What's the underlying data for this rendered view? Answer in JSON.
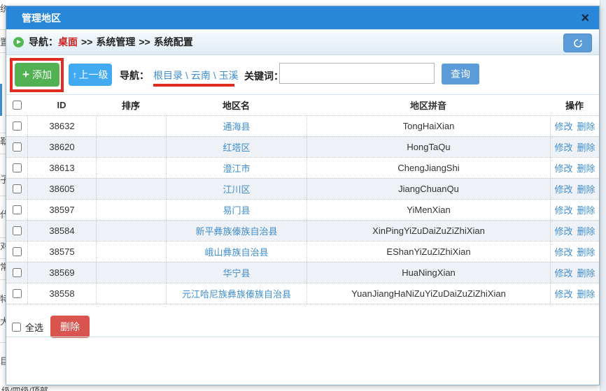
{
  "modal": {
    "title": "管理地区",
    "breadcrumb": {
      "label": "导航：",
      "desktop": "桌面",
      "separator": ">>",
      "item1": "系统管理",
      "item2": "系统配置"
    },
    "toolbar": {
      "add_label": "添加",
      "up_label": "上一级",
      "path_label": "导航：",
      "path_items": {
        "root": "根目录",
        "province": "云南",
        "city": "玉溪"
      },
      "path_separator": "\\",
      "keyword_label": "关键词：",
      "keyword_value": "",
      "query_label": "查询"
    },
    "table": {
      "headers": [
        "ID",
        "排序",
        "地区名",
        "地区拼音",
        "操作"
      ],
      "op_edit": "修改",
      "op_delete": "删除",
      "rows": [
        {
          "id": "38632",
          "sort": "",
          "name": "通海县",
          "pinyin": "TongHaiXian"
        },
        {
          "id": "38620",
          "sort": "",
          "name": "红塔区",
          "pinyin": "HongTaQu"
        },
        {
          "id": "38613",
          "sort": "",
          "name": "澄江市",
          "pinyin": "ChengJiangShi"
        },
        {
          "id": "38605",
          "sort": "",
          "name": "江川区",
          "pinyin": "JiangChuanQu"
        },
        {
          "id": "38597",
          "sort": "",
          "name": "易门县",
          "pinyin": "YiMenXian"
        },
        {
          "id": "38584",
          "sort": "",
          "name": "新平彝族傣族自治县",
          "pinyin": "XinPingYiZuDaiZuZiZhiXian"
        },
        {
          "id": "38575",
          "sort": "",
          "name": "峨山彝族自治县",
          "pinyin": "EShanYiZuZiZhiXian"
        },
        {
          "id": "38569",
          "sort": "",
          "name": "华宁县",
          "pinyin": "HuaNingXian"
        },
        {
          "id": "38558",
          "sort": "",
          "name": "元江哈尼族彝族傣族自治县",
          "pinyin": "YuanJiangHaNiZuYiZuDaiZuZiZhiXian"
        }
      ]
    },
    "footer": {
      "select_all_label": "全选",
      "delete_label": "删除"
    }
  },
  "icons": {
    "close": "×",
    "plus": "+",
    "up_arrow": "↑",
    "refresh": "refresh-circular-arrow",
    "play": "green-play-circle"
  },
  "background": {
    "left_fragments": [
      "统",
      "置",
      "勒",
      "子",
      "代",
      "对",
      "常",
      "特",
      "大",
      "巨"
    ],
    "bottom_text": "级/四级/顶部"
  },
  "colors": {
    "titlebar": "#2887d8",
    "add_green": "#52b153",
    "up_blue": "#41aaf1",
    "query_blue": "#5b9bd8",
    "delete_red": "#d9534f",
    "link_blue": "#3f8ecf",
    "annotation_red": "#e02b20",
    "desktop_red": "#cc2222",
    "row_stripe": "#eef1f6"
  }
}
